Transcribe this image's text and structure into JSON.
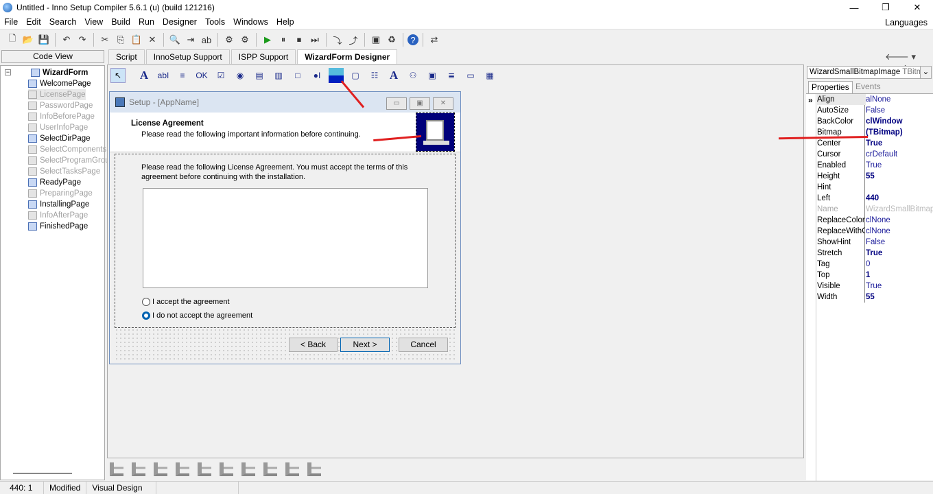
{
  "window": {
    "title": "Untitled - Inno Setup Compiler 5.6.1 (u) (build 121216)",
    "minimize": "—",
    "maximize": "❐",
    "close": "✕"
  },
  "menu": [
    "File",
    "Edit",
    "Search",
    "View",
    "Build",
    "Run",
    "Designer",
    "Tools",
    "Windows",
    "Help"
  ],
  "languages": "Languages",
  "toolbar_icons": [
    "new-file-icon",
    "open-icon",
    "save-icon",
    "undo-icon",
    "redo-icon",
    "cut-icon",
    "copy-icon",
    "paste-icon",
    "delete-icon",
    "find-icon",
    "find-next-icon",
    "replace-icon",
    "compile-icon",
    "compile-options-icon",
    "run-icon",
    "pause-icon",
    "stop-icon",
    "step-icon",
    "wizard-icon",
    "wizard2-icon",
    "designer-icon",
    "recycle-icon",
    "help-icon",
    "toggle-icon"
  ],
  "left": {
    "code_view": "Code View",
    "root": "WizardForm",
    "pages": [
      {
        "label": "WelcomePage",
        "enabled": true
      },
      {
        "label": "LicensePage",
        "enabled": false
      },
      {
        "label": "PasswordPage",
        "enabled": false
      },
      {
        "label": "InfoBeforePage",
        "enabled": false
      },
      {
        "label": "UserInfoPage",
        "enabled": false
      },
      {
        "label": "SelectDirPage",
        "enabled": true
      },
      {
        "label": "SelectComponents",
        "enabled": false
      },
      {
        "label": "SelectProgramGrou",
        "enabled": false
      },
      {
        "label": "SelectTasksPage",
        "enabled": false
      },
      {
        "label": "ReadyPage",
        "enabled": true
      },
      {
        "label": "PreparingPage",
        "enabled": false
      },
      {
        "label": "InstallingPage",
        "enabled": true
      },
      {
        "label": "InfoAfterPage",
        "enabled": false
      },
      {
        "label": "FinishedPage",
        "enabled": true
      }
    ]
  },
  "tabs": [
    {
      "label": "Script"
    },
    {
      "label": "InnoSetup Support"
    },
    {
      "label": "ISPP Support"
    },
    {
      "label": "WizardForm Designer",
      "active": true
    }
  ],
  "palette": [
    "↖",
    "A",
    "abI",
    "≡",
    "OK",
    "☑",
    "◉",
    "▤",
    "▥",
    "□",
    "●I",
    "▬",
    "▢",
    "☷",
    "A",
    "⚇",
    "▣",
    "≣",
    "▭",
    "▦"
  ],
  "form": {
    "caption": "Setup - [AppName]",
    "heading": "License Agreement",
    "subheading": "Please read the following important information before continuing.",
    "intro": "Please read the following License Agreement. You must accept the terms of this agreement before continuing with the installation.",
    "accept": "I accept the agreement",
    "decline": "I do not accept the agreement",
    "decline_selected": true,
    "back": "< Back",
    "next": "Next >",
    "cancel": "Cancel"
  },
  "inspector": {
    "component": "WizardSmallBitmapImage",
    "type": "TBitmap",
    "tab_properties": "Properties",
    "tab_events": "Events",
    "properties": [
      {
        "name": "Align",
        "value": "alNone",
        "bold": false
      },
      {
        "name": "AutoSize",
        "value": "False",
        "bold": false
      },
      {
        "name": "BackColor",
        "value": "clWindow",
        "bold": true
      },
      {
        "name": "Bitmap",
        "value": "(TBitmap)",
        "bold": true
      },
      {
        "name": "Center",
        "value": "True",
        "bold": true
      },
      {
        "name": "Cursor",
        "value": "crDefault",
        "bold": false
      },
      {
        "name": "Enabled",
        "value": "True",
        "bold": false
      },
      {
        "name": "Height",
        "value": "55",
        "bold": true
      },
      {
        "name": "Hint",
        "value": "",
        "bold": false
      },
      {
        "name": "Left",
        "value": "440",
        "bold": true
      },
      {
        "name": "Name",
        "value": "WizardSmallBitmapIr",
        "bold": false,
        "disabled": true
      },
      {
        "name": "ReplaceColor",
        "value": "clNone",
        "bold": false
      },
      {
        "name": "ReplaceWithC",
        "value": "clNone",
        "bold": false
      },
      {
        "name": "ShowHint",
        "value": "False",
        "bold": false
      },
      {
        "name": "Stretch",
        "value": "True",
        "bold": true
      },
      {
        "name": "Tag",
        "value": "0",
        "bold": false
      },
      {
        "name": "Top",
        "value": "1",
        "bold": true
      },
      {
        "name": "Visible",
        "value": "True",
        "bold": false
      },
      {
        "name": "Width",
        "value": "55",
        "bold": true
      }
    ]
  },
  "align_icons": [
    "align-left-icon",
    "align-right-icon",
    "align-width-icon",
    "align-center-icon",
    "align-right-edge-icon",
    "align-top-icon",
    "align-middle-icon",
    "align-height-icon",
    "space-vert-icon",
    "align-bottom-icon"
  ],
  "status": {
    "position": "440:  1",
    "modified": "Modified",
    "mode": "Visual Design"
  },
  "colors": {
    "accent": "#000080",
    "arrow": "#e02020"
  }
}
